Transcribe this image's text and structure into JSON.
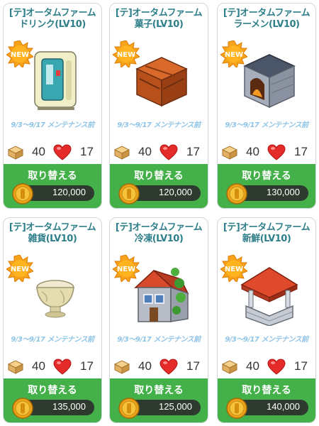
{
  "cards": [
    {
      "title_line1": "[テ]オータムファーム",
      "title_line2": "ドリンク(LV10)",
      "art": "vending-machine",
      "notice": "9/3～9/17 メンテナンス前",
      "box_count": "40",
      "heart_count": "17",
      "exchange_label": "取り替える",
      "price": "120,000"
    },
    {
      "title_line1": "[テ]オータムファーム",
      "title_line2": "菓子(LV10)",
      "art": "wooden-crate",
      "notice": "9/3～9/17 メンテナンス前",
      "box_count": "40",
      "heart_count": "17",
      "exchange_label": "取り替える",
      "price": "120,000"
    },
    {
      "title_line1": "[テ]オータムファーム",
      "title_line2": "ラーメン(LV10)",
      "art": "stone-oven",
      "notice": "9/3～9/17 メンテナンス前",
      "box_count": "40",
      "heart_count": "17",
      "exchange_label": "取り替える",
      "price": "130,000"
    },
    {
      "title_line1": "[テ]オータムファーム",
      "title_line2": "雑貨(LV10)",
      "art": "marble-bowl",
      "notice": "9/3～9/17 メンテナンス前",
      "box_count": "40",
      "heart_count": "17",
      "exchange_label": "取り替える",
      "price": "135,000"
    },
    {
      "title_line1": "[テ]オータムファーム",
      "title_line2": "冷凍(LV10)",
      "art": "ivy-house",
      "notice": "9/3～9/17 メンテナンス前",
      "box_count": "40",
      "heart_count": "17",
      "exchange_label": "取り替える",
      "price": "125,000"
    },
    {
      "title_line1": "[テ]オータムファーム",
      "title_line2": "新鮮(LV10)",
      "art": "stone-well",
      "notice": "9/3～9/17 メンテナンス前",
      "box_count": "40",
      "heart_count": "17",
      "exchange_label": "取り替える",
      "price": "140,000"
    }
  ],
  "new_badge_text": "NEW",
  "colors": {
    "title": "#2e7f8a",
    "button": "#43b049",
    "notice": "#8fc4e6",
    "heart": "#e52a2a"
  }
}
